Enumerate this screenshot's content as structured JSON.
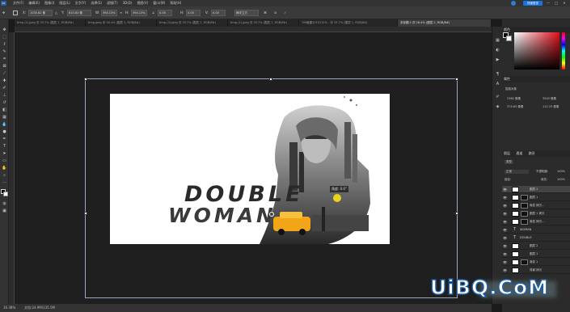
{
  "menubar": {
    "logo": "Ps",
    "items": [
      "文件(F)",
      "编辑(E)",
      "图像(I)",
      "图层(L)",
      "文字(Y)",
      "选择(S)",
      "滤镜(T)",
      "3D(D)",
      "视图(V)",
      "窗口(W)",
      "帮助(H)"
    ],
    "login_label": "快速登录"
  },
  "options": {
    "x_label": "X:",
    "x_value": "1035.82 像",
    "y_label": "Y:",
    "y_value": "610.83 像",
    "w_label": "W:",
    "w_value": "394.13%",
    "h_label": "H:",
    "h_value": "394.13%",
    "angle_value": "0.00",
    "h_skew_label": "H:",
    "h_skew_value": "0.00",
    "v_skew_label": "V:",
    "v_skew_value": "0.00",
    "interp": "两次立方"
  },
  "tabs": [
    {
      "label": "timg (2).jpeg @ 33.7% (图层 1, RGB/8#)",
      "active": false
    },
    {
      "label": "timg.jpeg @ 16.4% (图层 1, RGB/8#)",
      "active": false
    },
    {
      "label": "timg (3).jpeg @ 33.7% (图层 1, RGB/8#)",
      "active": false
    },
    {
      "label": "timg (1).jpeg @ 33.7% (图层 1, RGB/8#)",
      "active": false
    },
    {
      "label": "TIM截图20191119... @ 33.7% (图层 1, RGB/8#)",
      "active": false
    },
    {
      "label": "未标题-1 @ 16.4% (图层 2, RGB/8#)",
      "active": true
    }
  ],
  "artwork": {
    "title_line1": "DOUBLE",
    "title_line2": "WOMAN",
    "tooltip": "角度: 0.0°"
  },
  "status": {
    "zoom": "16.38%",
    "doc": "文档:24.9M/135.5M"
  },
  "panels": {
    "color_tab": "颜色",
    "props_tab": "属性",
    "props_sub": "智能对象",
    "w_value": "2362 像素",
    "h_value": "3543 像素",
    "x_value": "374.63 像素",
    "y_value": "112.33 像素",
    "layers_tab": "图层",
    "channels_tab": "通道",
    "paths_tab": "路径",
    "kind_label": "类型",
    "blend_mode": "正常",
    "opacity_label": "不透明度:",
    "opacity_value": "100%",
    "lock_label": "锁定:",
    "fill_label": "填充:",
    "fill_value": "100%"
  },
  "layers": [
    {
      "name": "图层 2",
      "kind": "pixel",
      "selected": true
    },
    {
      "name": "图层 1",
      "kind": "mask",
      "selected": false
    },
    {
      "name": "渐变 拷贝...",
      "kind": "mask",
      "selected": false
    },
    {
      "name": "图层 1 拷贝",
      "kind": "mask",
      "selected": false
    },
    {
      "name": "渐变 拷贝...",
      "kind": "mask",
      "selected": false
    },
    {
      "name": "WOMAN",
      "kind": "text",
      "selected": false
    },
    {
      "name": "DOUBLE",
      "kind": "text",
      "selected": false
    },
    {
      "name": "图层 2",
      "kind": "pixel",
      "selected": false
    },
    {
      "name": "图层 1",
      "kind": "pixel",
      "selected": false
    },
    {
      "name": "渐变 1",
      "kind": "mask",
      "selected": false
    },
    {
      "name": "背景 拷贝",
      "kind": "pixel",
      "selected": false
    }
  ],
  "watermark": "UiBQ.CoM",
  "colors": {
    "accent": "#1473e6",
    "canvas_bg": "#1f1f1f",
    "panel_bg": "#2b2b2b"
  }
}
